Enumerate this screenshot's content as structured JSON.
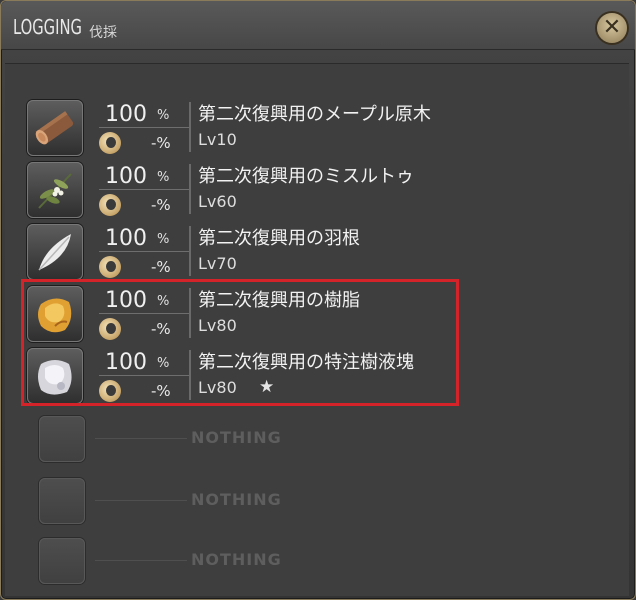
{
  "window": {
    "title": "LOGGING",
    "subtitle": "伐採",
    "close_label": "✕"
  },
  "items": [
    {
      "percent": "100",
      "percent_sign": "%",
      "hq_value": "-%",
      "name": "第二次復興用のメープル原木",
      "level": "Lv10",
      "star": "",
      "icon": "log-icon"
    },
    {
      "percent": "100",
      "percent_sign": "%",
      "hq_value": "-%",
      "name": "第二次復興用のミスルトゥ",
      "level": "Lv60",
      "star": "",
      "icon": "mistletoe-icon"
    },
    {
      "percent": "100",
      "percent_sign": "%",
      "hq_value": "-%",
      "name": "第二次復興用の羽根",
      "level": "Lv70",
      "star": "",
      "icon": "feather-icon"
    },
    {
      "percent": "100",
      "percent_sign": "%",
      "hq_value": "-%",
      "name": "第二次復興用の樹脂",
      "level": "Lv80",
      "star": "",
      "icon": "resin-icon"
    },
    {
      "percent": "100",
      "percent_sign": "%",
      "hq_value": "-%",
      "name": "第二次復興用の特注樹液塊",
      "level": "Lv80",
      "star": "★",
      "icon": "sap-chunk-icon"
    }
  ],
  "empty_slots": [
    {
      "label": "NOTHING"
    },
    {
      "label": "NOTHING"
    },
    {
      "label": "NOTHING"
    }
  ],
  "colors": {
    "highlight": "#d4242a"
  }
}
